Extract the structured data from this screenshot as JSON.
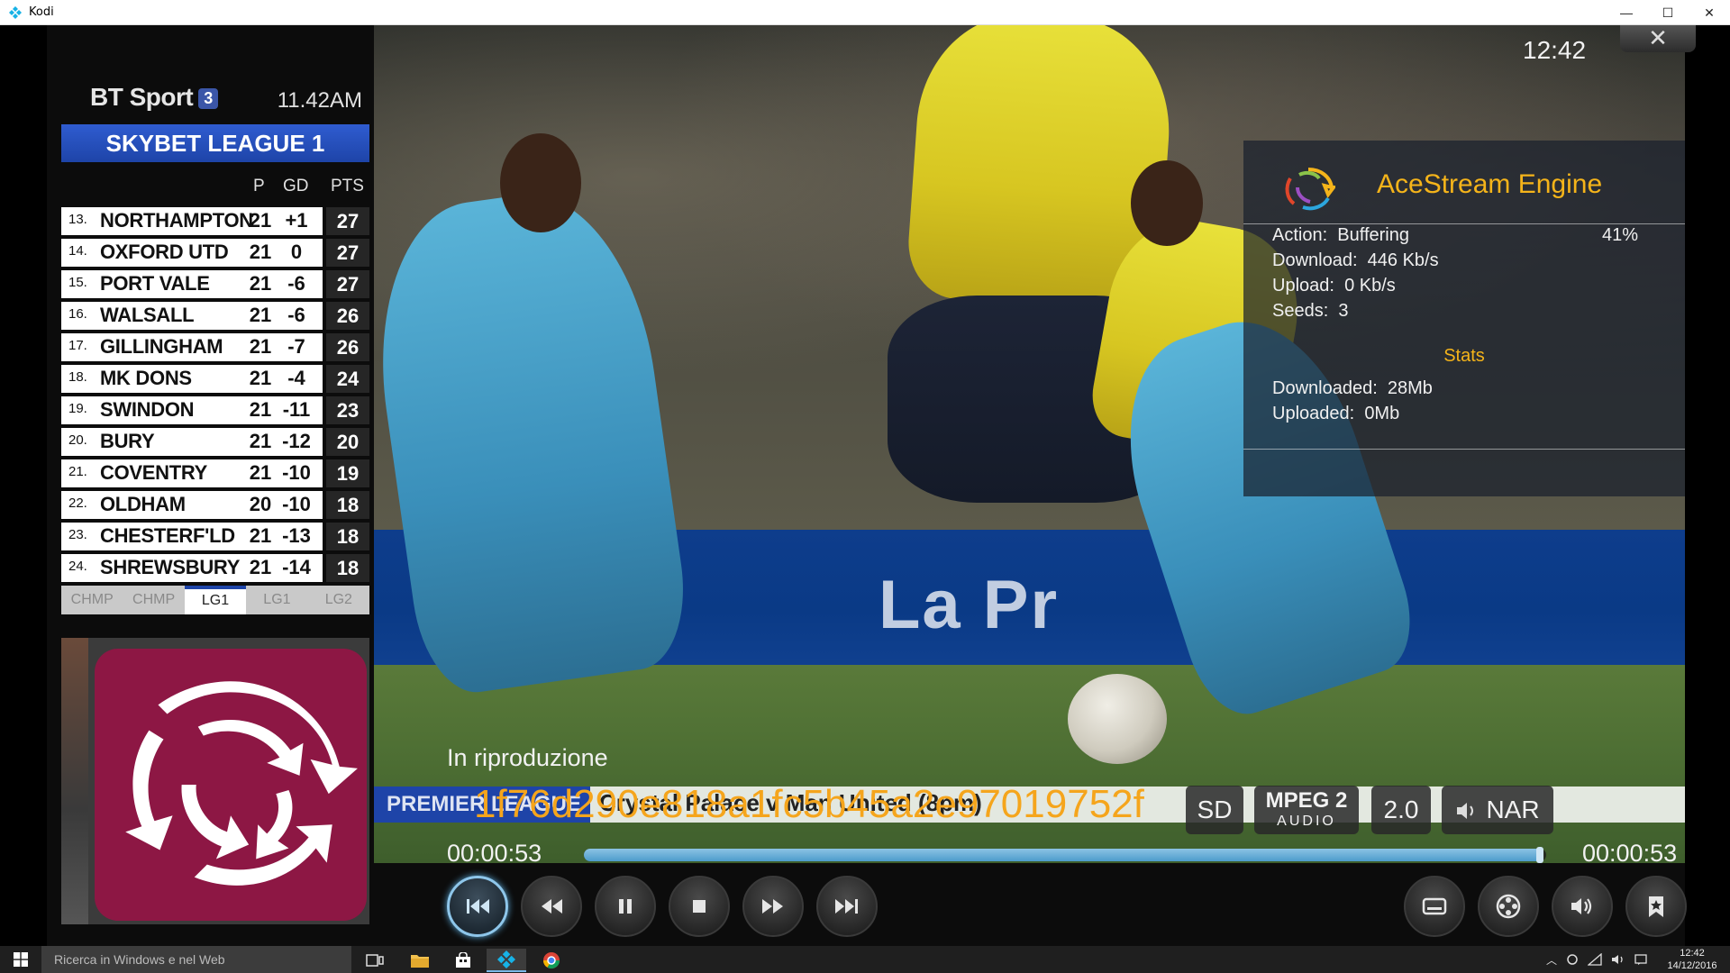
{
  "window": {
    "title": "Kodi",
    "minimize": "—",
    "maximize": "☐",
    "close": "✕"
  },
  "league_table": {
    "channel": "BT Sport",
    "channel_number": "3",
    "clock": "11.42AM",
    "banner": "SKYBET LEAGUE 1",
    "columns": {
      "p": "P",
      "gd": "GD",
      "pts": "PTS"
    },
    "rows": [
      {
        "pos": "13.",
        "team": "NORTHAMPTON",
        "p": "21",
        "gd": "+1",
        "pts": "27"
      },
      {
        "pos": "14.",
        "team": "OXFORD UTD",
        "p": "21",
        "gd": "0",
        "pts": "27"
      },
      {
        "pos": "15.",
        "team": "PORT VALE",
        "p": "21",
        "gd": "-6",
        "pts": "27"
      },
      {
        "pos": "16.",
        "team": "WALSALL",
        "p": "21",
        "gd": "-6",
        "pts": "26"
      },
      {
        "pos": "17.",
        "team": "GILLINGHAM",
        "p": "21",
        "gd": "-7",
        "pts": "26"
      },
      {
        "pos": "18.",
        "team": "MK DONS",
        "p": "21",
        "gd": "-4",
        "pts": "24"
      },
      {
        "pos": "19.",
        "team": "SWINDON",
        "p": "21",
        "gd": "-11",
        "pts": "23"
      },
      {
        "pos": "20.",
        "team": "BURY",
        "p": "21",
        "gd": "-12",
        "pts": "20"
      },
      {
        "pos": "21.",
        "team": "COVENTRY",
        "p": "21",
        "gd": "-10",
        "pts": "19"
      },
      {
        "pos": "22.",
        "team": "OLDHAM",
        "p": "20",
        "gd": "-10",
        "pts": "18"
      },
      {
        "pos": "23.",
        "team": "CHESTERF'LD",
        "p": "21",
        "gd": "-13",
        "pts": "18"
      },
      {
        "pos": "24.",
        "team": "SHREWSBURY",
        "p": "21",
        "gd": "-14",
        "pts": "18"
      }
    ],
    "tabs": [
      {
        "label": "CHMP",
        "active": false
      },
      {
        "label": "CHMP",
        "active": false
      },
      {
        "label": "LG1",
        "active": true
      },
      {
        "label": "LG1",
        "active": false
      },
      {
        "label": "LG2",
        "active": false
      }
    ]
  },
  "scene": {
    "board_text": "La Pr",
    "ticker_league": "PREMIER LEAGUE",
    "ticker_match": "Crystal Palace v Man United (8pm)"
  },
  "acestream": {
    "title": "AceStream Engine",
    "action_label": "Action:",
    "action_value": "Buffering",
    "percent": "41%",
    "download_label": "Download:",
    "download_value": "446 Kb/s",
    "upload_label": "Upload:",
    "upload_value": "0 Kb/s",
    "seeds_label": "Seeds:",
    "seeds_value": "3",
    "stats_title": "Stats",
    "downloaded_label": "Downloaded:",
    "downloaded_value": "28Mb",
    "uploaded_label": "Uploaded:",
    "uploaded_value": "0Mb"
  },
  "osd": {
    "clock": "12:42",
    "close": "✕",
    "now_playing_label": "In riproduzione",
    "media_title": "1f76d290e818a1fc5b45a2e97019752f",
    "badges": {
      "video": "SD",
      "audio_codec_top": "MPEG 2",
      "audio_codec_bottom": "AUDIO",
      "channels": "2.0",
      "language": "NAR"
    },
    "time_elapsed": "00:00:53",
    "time_total": "00:00:53",
    "progress": 0.995
  },
  "taskbar": {
    "search_placeholder": "Ricerca in Windows e nel Web",
    "time": "12:42",
    "date": "14/12/2016"
  },
  "colors": {
    "accent_orange": "#f5a51c",
    "ace_title": "#f5b41a",
    "league_blue": "#1e44a8",
    "logo_maroon": "#8d1744",
    "progress_blue": "#4d9ccc"
  }
}
